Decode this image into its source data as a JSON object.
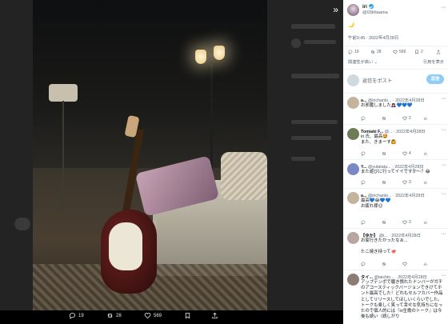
{
  "media": {
    "expand_icon": "»",
    "bar": {
      "replies": "19",
      "retweets": "28",
      "likes": "569"
    }
  },
  "tweet": {
    "author_name": "iri",
    "author_handle": "@03iritaama",
    "emoji": "🌙",
    "timestamp": "午前0:45 · 2022年4月28日",
    "stats": {
      "replies": "19",
      "retweets": "28",
      "likes": "569",
      "bookmarks": "2"
    },
    "relevance_label": "関連性が高い",
    "quote_label": "引用を表示",
    "reply_placeholder": "返信をポスト",
    "reply_button": "返信"
  },
  "replies": [
    {
      "name": "a...",
      "handle": "@irichanlo...",
      "date": "· 2022年4月28日",
      "text": "お邪魔しました🙇‍♀️💙💙💙",
      "counts": {
        "replies": "",
        "retweets": "",
        "likes": "2",
        "views": ""
      },
      "avatar_color": "#c2b49d"
    },
    {
      "name": "Tomiaki F...",
      "handle": "@...",
      "date": "· 2022年4月28日",
      "text": "iri 氏、最高🤩\nまた、きまーす🙆",
      "counts": {
        "replies": "",
        "retweets": "",
        "likes": "4",
        "views": ""
      },
      "avatar_color": "#6e7b54"
    },
    {
      "name": "Y...",
      "handle": "@yutatata...",
      "date": "· 2022年4月28日",
      "text": "また遊びに行ってイイですか～？😂",
      "counts": {
        "replies": "",
        "retweets": "",
        "likes": "3",
        "views": ""
      },
      "avatar_color": "#7a88c6"
    },
    {
      "name": "a...",
      "handle": "@irichanlo...",
      "date": "· 2022年4月28日",
      "text": "最高💙😂💙💙\nお疲れ様😉",
      "counts": {
        "replies": "",
        "retweets": "",
        "likes": "3",
        "views": ""
      },
      "avatar_color": "#c2b49d"
    },
    {
      "name": "【ゆか】",
      "handle": "@i...",
      "date": "· 2022年4月28日",
      "text": "お家行きたかったなぁ...\n\nたこ焼き持って🐙",
      "counts": {
        "replies": "",
        "retweets": "",
        "likes": "",
        "views": ""
      },
      "avatar_color": "#b8a7a0"
    },
    {
      "name": "タイ...",
      "handle": "@taichin...",
      "date": "· 2022年4月28日",
      "text": "アップテンポで聴き慣れたナンバーがガチのアコースティックバージョンできけてホント最高でした！どれもセルフカバー作品としてリリースしてほしいくらいでした。トークも楽しく笑って幸せな気持ちになったので個人的には『iri生歌のトーク』は今後も続い（続しがり",
      "counts": {
        "replies": "",
        "retweets": "",
        "likes": "",
        "views": ""
      },
      "avatar_color": "#8c7d74"
    }
  ],
  "colors": {
    "accent": "#1d9bf0",
    "muted": "#536471",
    "text": "#0f1419"
  }
}
